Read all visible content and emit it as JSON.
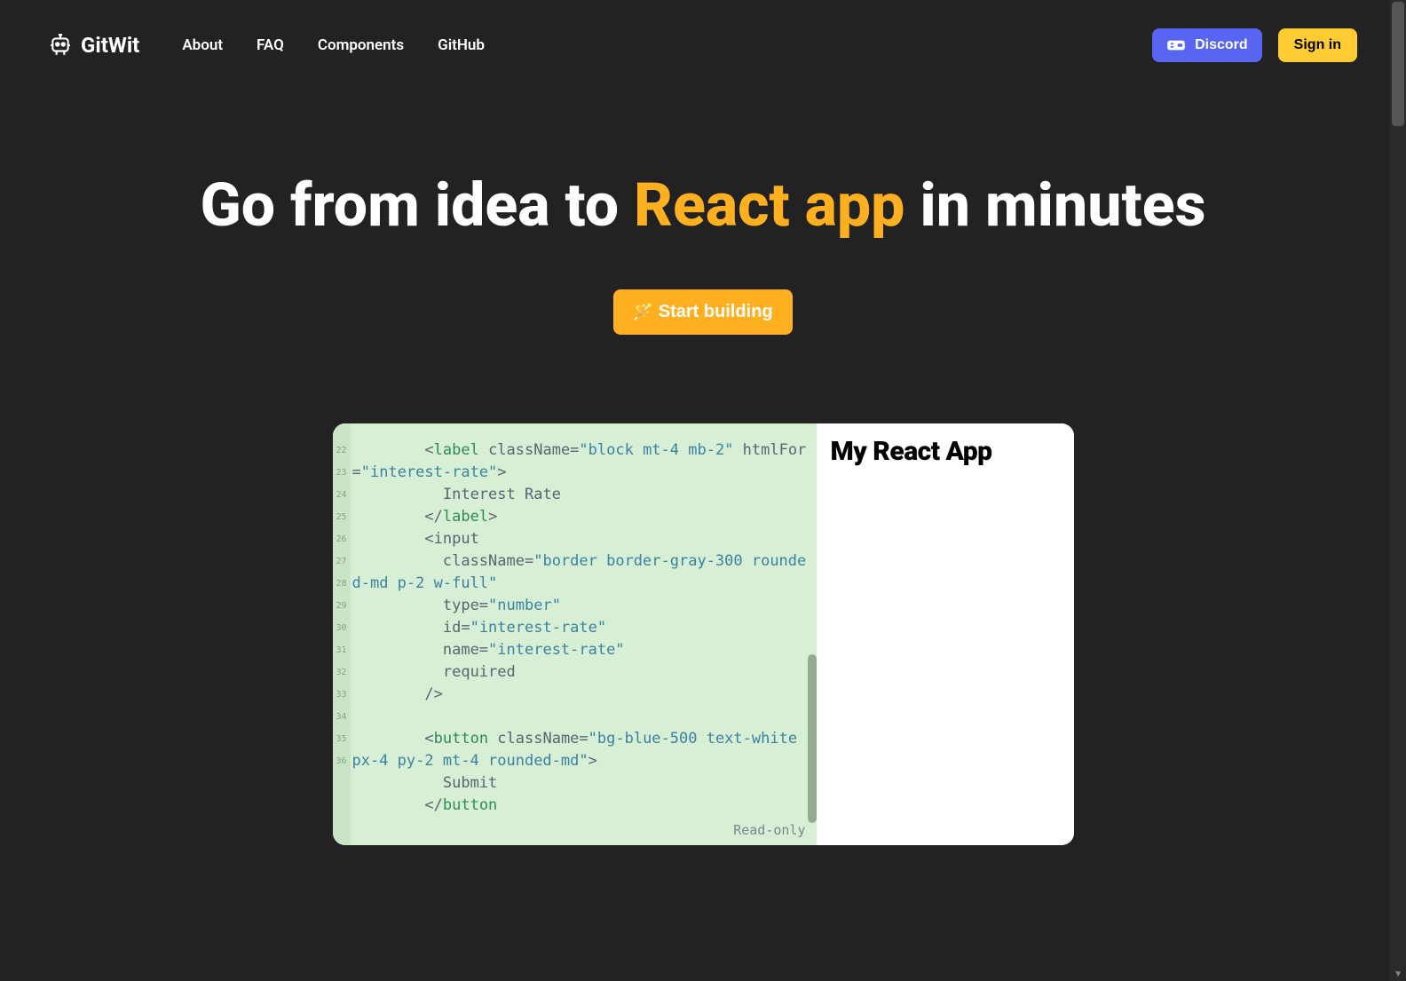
{
  "header": {
    "brand": "GitWit",
    "nav": {
      "about": "About",
      "faq": "FAQ",
      "components": "Components",
      "github": "GitHub"
    },
    "discord": "Discord",
    "signin": "Sign in"
  },
  "hero": {
    "title_pre": "Go from idea to ",
    "title_highlight": "React app",
    "title_post": " in minutes",
    "cta": "Start building"
  },
  "demo": {
    "preview_heading": "My React App",
    "readonly_label": "Read-only",
    "line_numbers": [
      "22",
      "23",
      "",
      "24",
      "25",
      "26",
      "27",
      "",
      "28",
      "29",
      "30",
      "31",
      "32",
      "33",
      "34",
      "",
      "35",
      "36"
    ],
    "code": {
      "l23a": "        <",
      "l23b": "label",
      "l23c": " className=",
      "l23d": "\"block mt-4 mb-2\"",
      "l23e": " htmlFor=",
      "l23f": "\"interest-rate\"",
      "l23g": ">",
      "l24": "          Interest Rate",
      "l25a": "        </",
      "l25b": "label",
      "l25c": ">",
      "l26": "        <input",
      "l27a": "          className=",
      "l27b": "\"border border-gray-300 rounded-md p-2 w-full\"",
      "l28a": "          type=",
      "l28b": "\"number\"",
      "l29a": "          id=",
      "l29b": "\"interest-rate\"",
      "l30a": "          name=",
      "l30b": "\"interest-rate\"",
      "l31": "          required",
      "l32": "        />",
      "l33": "",
      "l34a": "        <",
      "l34b": "button",
      "l34c": " className=",
      "l34d": "\"bg-blue-500 text-white px-4 py-2 mt-4 rounded-md\"",
      "l34e": ">",
      "l35": "          Submit",
      "l36a": "        </",
      "l36b": "button"
    }
  }
}
